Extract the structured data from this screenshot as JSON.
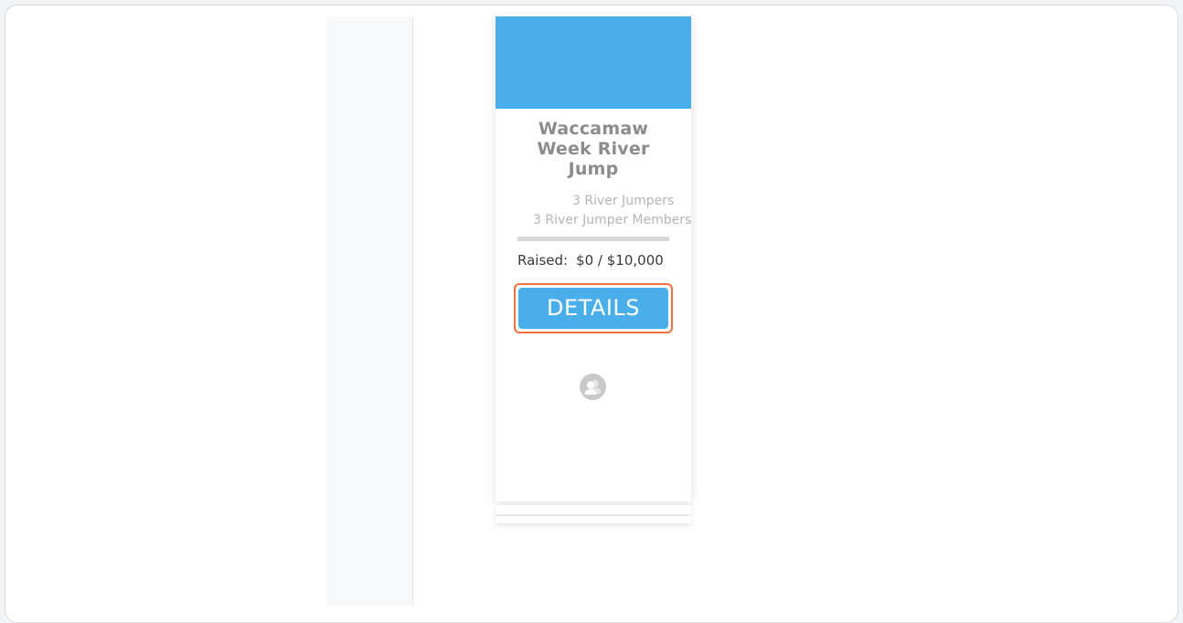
{
  "campaign_card": {
    "banner_color": "#49aeea",
    "title": "Waccamaw Week River Jump",
    "jumpers": "3 River Jumpers",
    "members": "3 River Jumper Members",
    "progress_fraction": 0,
    "raised_label": "Raised:",
    "raised_amount": "$0 / $10,000",
    "details_button": "DETAILS",
    "button_color": "#49aeea",
    "highlight_color": "#f0713d",
    "avatar_icon": "user-group-icon"
  }
}
